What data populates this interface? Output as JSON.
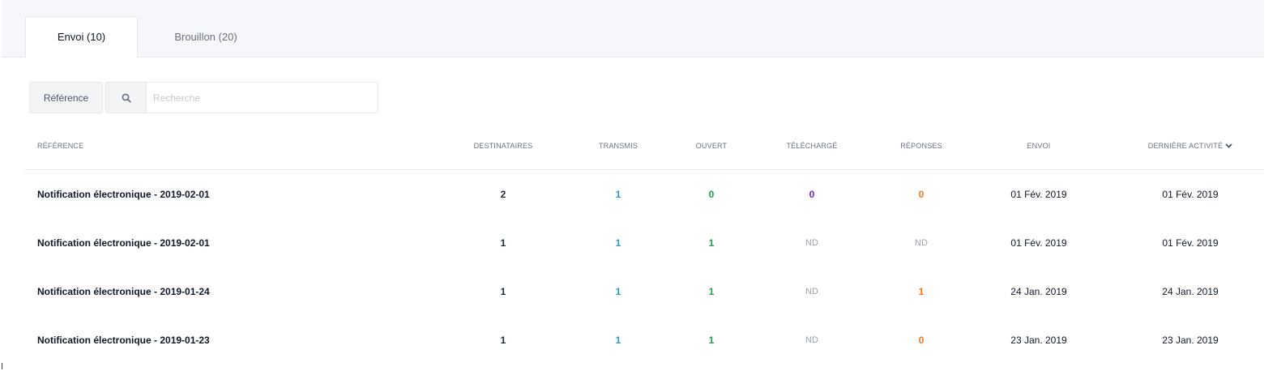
{
  "tabs": [
    {
      "label": "Envoi (10)",
      "active": true
    },
    {
      "label": "Brouillon (20)",
      "active": false
    }
  ],
  "filter": {
    "reference_button": "Référence",
    "search_icon": "search-icon",
    "search_placeholder": "Recherche",
    "search_value": ""
  },
  "table": {
    "columns": {
      "reference": "RÉFÉRENCE",
      "destinataires": "DESTINATAIRES",
      "transmis": "TRANSMIS",
      "ouvert": "OUVERT",
      "telecharge": "TÉLÉCHARGÉ",
      "reponses": "RÉPONSES",
      "envoi": "ENVOI",
      "derniere_activite": "DERNIÈRE ACTIVITÉ"
    },
    "sort_icon": "chevron-down-icon",
    "rows": [
      {
        "reference": "Notification électronique - 2019-02-01",
        "destinataires": "2",
        "transmis": "1",
        "ouvert": "0",
        "telecharge": "0",
        "reponses": "0",
        "envoi": "01 Fév. 2019",
        "derniere_activite": "01 Fév. 2019"
      },
      {
        "reference": "Notification électronique - 2019-02-01",
        "destinataires": "1",
        "transmis": "1",
        "ouvert": "1",
        "telecharge": "ND",
        "reponses": "ND",
        "envoi": "01 Fév. 2019",
        "derniere_activite": "01 Fév. 2019"
      },
      {
        "reference": "Notification électronique - 2019-01-24",
        "destinataires": "1",
        "transmis": "1",
        "ouvert": "1",
        "telecharge": "ND",
        "reponses": "1",
        "envoi": "24 Jan. 2019",
        "derniere_activite": "24 Jan. 2019"
      },
      {
        "reference": "Notification électronique - 2019-01-23",
        "destinataires": "1",
        "transmis": "1",
        "ouvert": "1",
        "telecharge": "ND",
        "reponses": "0",
        "envoi": "23 Jan. 2019",
        "derniere_activite": "23 Jan. 2019"
      }
    ]
  },
  "colors": {
    "transmis": "#2b9bb8",
    "ouvert": "#16a34a",
    "telecharge": "#7e22ce",
    "reponses": "#f97316",
    "nd": "#9ca3af"
  }
}
